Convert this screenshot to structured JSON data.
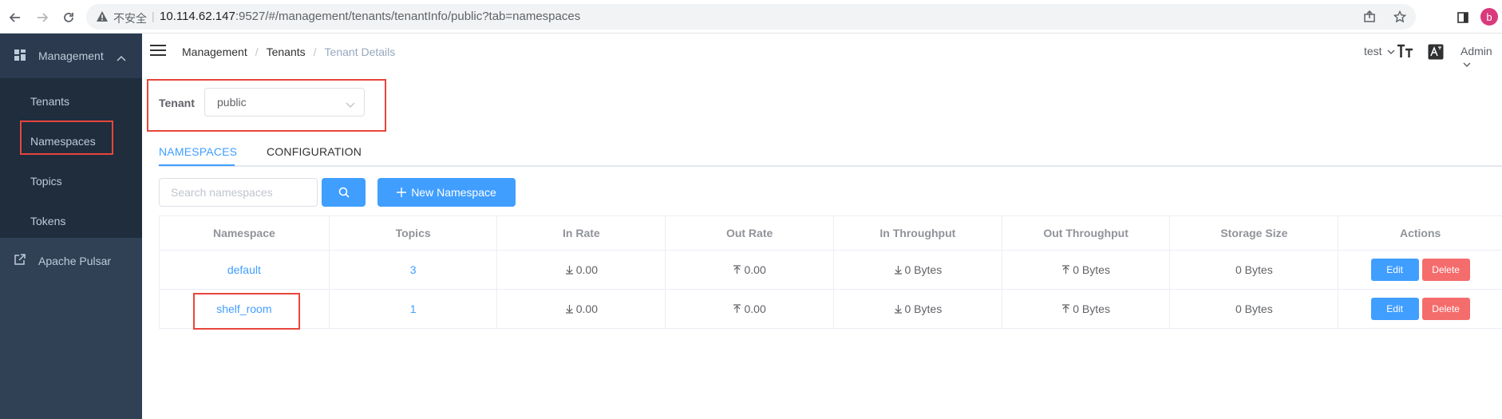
{
  "browser": {
    "security_label": "不安全",
    "url_host": "10.114.62.147",
    "url_rest": ":9527/#/management/tenants/tenantInfo/public?tab=namespaces",
    "profile_initial": "b"
  },
  "sidebar": {
    "management_label": "Management",
    "items": [
      {
        "label": "Tenants"
      },
      {
        "label": "Namespaces"
      },
      {
        "label": "Topics"
      },
      {
        "label": "Tokens"
      }
    ],
    "external_label": "Apache Pulsar"
  },
  "header": {
    "breadcrumb": [
      "Management",
      "Tenants",
      "Tenant Details"
    ],
    "env_label": "test",
    "user_label": "Admin"
  },
  "tenant": {
    "label": "Tenant",
    "value": "public"
  },
  "tabs": [
    {
      "label": "NAMESPACES",
      "active": true
    },
    {
      "label": "CONFIGURATION",
      "active": false
    }
  ],
  "search": {
    "placeholder": "Search namespaces"
  },
  "new_button_label": "New Namespace",
  "table": {
    "columns": [
      "Namespace",
      "Topics",
      "In Rate",
      "Out Rate",
      "In Throughput",
      "Out Throughput",
      "Storage Size",
      "Actions"
    ],
    "rows": [
      {
        "namespace": "default",
        "topics": "3",
        "in_rate": "0.00",
        "out_rate": "0.00",
        "in_throughput": "0 Bytes",
        "out_throughput": "0 Bytes",
        "storage": "0 Bytes",
        "edit": "Edit",
        "delete": "Delete"
      },
      {
        "namespace": "shelf_room",
        "topics": "1",
        "in_rate": "0.00",
        "out_rate": "0.00",
        "in_throughput": "0 Bytes",
        "out_throughput": "0 Bytes",
        "storage": "0 Bytes",
        "edit": "Edit",
        "delete": "Delete"
      }
    ]
  },
  "colors": {
    "primary": "#409eff",
    "danger": "#f56c6c",
    "sidebar_bg": "#304156",
    "highlight_box": "#e8453c"
  }
}
